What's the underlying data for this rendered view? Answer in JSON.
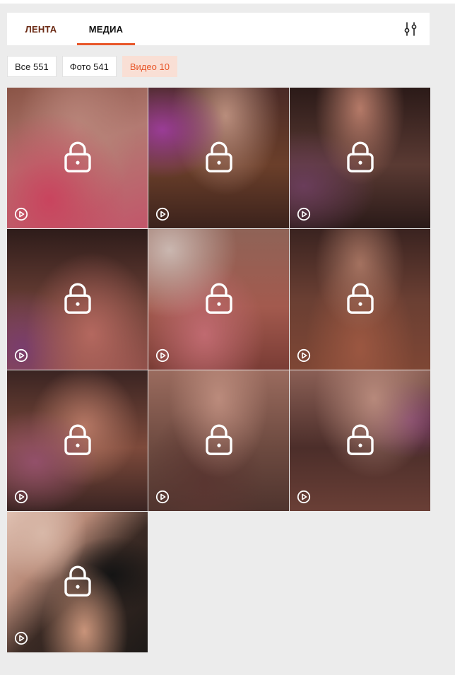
{
  "tabs": {
    "feed_label": "ЛЕНТА",
    "media_label": "МЕДИА",
    "active": "media"
  },
  "filter_icon": "sliders-icon",
  "chips": {
    "all_label": "Все 551",
    "photo_label": "Фото 541",
    "video_label": "Видео 10",
    "active": "video"
  },
  "media": {
    "count": 10,
    "items": [
      {
        "type": "video",
        "locked": true
      },
      {
        "type": "video",
        "locked": true
      },
      {
        "type": "video",
        "locked": true
      },
      {
        "type": "video",
        "locked": true
      },
      {
        "type": "video",
        "locked": true
      },
      {
        "type": "video",
        "locked": true
      },
      {
        "type": "video",
        "locked": true
      },
      {
        "type": "video",
        "locked": true
      },
      {
        "type": "video",
        "locked": true
      },
      {
        "type": "video",
        "locked": true
      }
    ],
    "overlay_icons": [
      "lock-icon",
      "play-circle-icon"
    ]
  },
  "colors": {
    "accent": "#e8572a",
    "chip_active_bg": "#f9dfd5",
    "page_bg": "#ececec"
  }
}
